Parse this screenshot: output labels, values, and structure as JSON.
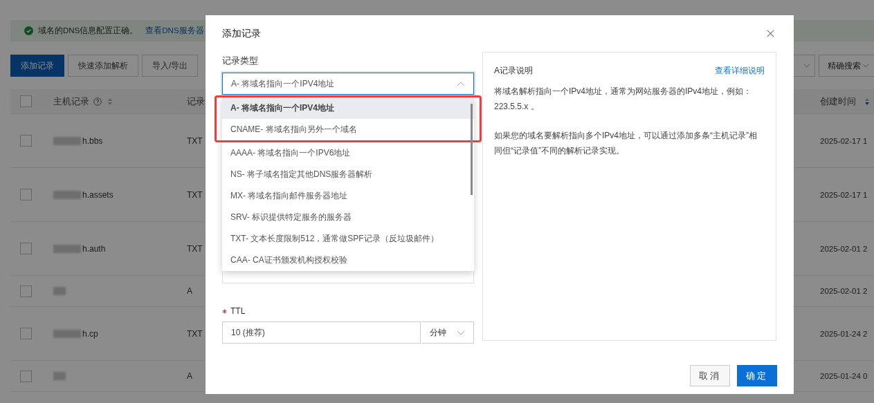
{
  "page": {
    "banner": {
      "text": "域名的DNS信息配置正确。",
      "link": "查看DNS服务器"
    },
    "toolbar": {
      "buttons": [
        {
          "label": "添加记录",
          "kind": "primary"
        },
        {
          "label": "快速添加解析",
          "kind": "default"
        },
        {
          "label": "导入/导出",
          "kind": "default"
        }
      ],
      "search_mode": "精确搜索"
    },
    "table": {
      "all_checked": false,
      "columns": [
        {
          "label": "主机记录",
          "kind": "host"
        },
        {
          "label": "记录",
          "kind": "type"
        },
        {
          "label": "创建时间",
          "kind": "created"
        }
      ],
      "rows": [
        {
          "checked": false,
          "host": "h.bbs",
          "type": "TXT",
          "created": "2025-02-17 1"
        },
        {
          "checked": false,
          "host": "h.assets",
          "type": "TXT",
          "created": "2025-02-17 1"
        },
        {
          "checked": false,
          "host": "h.auth",
          "type": "TXT",
          "created": "2025-02-01 2"
        },
        {
          "checked": false,
          "type": "A",
          "created": "2025-02-01 2"
        },
        {
          "checked": false,
          "host": "h.cp",
          "type": "TXT",
          "created": "2025-01-24 2"
        },
        {
          "checked": false,
          "type": "A",
          "created": "2025-01-24 0"
        }
      ]
    }
  },
  "dialog": {
    "title": "添加记录",
    "record_type": {
      "label": "记录类型",
      "value": "A- 将域名指向一个IPV4地址",
      "expanded": true,
      "options": [
        {
          "label": "A- 将域名指向一个IPV4地址",
          "selected": true,
          "highlighted": true
        },
        {
          "label": "CNAME- 将域名指向另外一个域名",
          "selected": false,
          "highlighted": true
        },
        {
          "label": "AAAA- 将域名指向一个IPV6地址",
          "selected": false,
          "highlighted": false
        },
        {
          "label": "NS- 将子域名指定其他DNS服务器解析",
          "selected": false,
          "highlighted": false
        },
        {
          "label": "MX- 将域名指向邮件服务器地址",
          "selected": false,
          "highlighted": false
        },
        {
          "label": "SRV- 标识提供特定服务的服务器",
          "selected": false,
          "highlighted": false
        },
        {
          "label": "TXT- 文本长度限制512，通常做SPF记录（反垃圾邮件）",
          "selected": false,
          "highlighted": false
        },
        {
          "label": "CAA- CA证书颁发机构授权校验",
          "selected": false,
          "highlighted": false
        }
      ]
    },
    "ttl": {
      "label": "TTL",
      "required": true,
      "value": "10 (推荐)",
      "unit": "分钟"
    },
    "info": {
      "title": "A记录说明",
      "link": "查看详细说明",
      "paragraphs": [
        "将域名解析指向一个IPv4地址，通常为网站服务器的IPv4地址，例如：223.5.5.x 。",
        "如果您的域名要解析指向多个IPv4地址，可以通过添加多条“主机记录”相同但“记录值”不同的解析记录实现。"
      ]
    },
    "buttons": [
      {
        "label": "取消",
        "kind": "default"
      },
      {
        "label": "确定",
        "kind": "primary"
      }
    ]
  }
}
